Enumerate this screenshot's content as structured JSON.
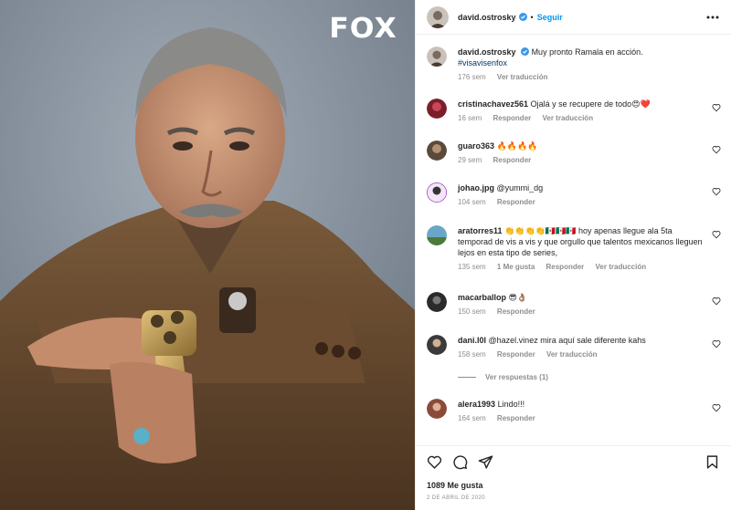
{
  "media": {
    "brand": "FOX"
  },
  "header": {
    "username": "david.ostrosky",
    "separator": "•",
    "follow_label": "Seguir"
  },
  "caption": {
    "username": "david.ostrosky",
    "text": "Muy pronto Ramala en acción.",
    "hashtag": "#visavisenfox",
    "time": "176 sem",
    "translate": "Ver traducción"
  },
  "comments": [
    {
      "username": "cristinachavez561",
      "text": "Ojalá y se recupere de todo😍❤️",
      "time": "16 sem",
      "likes": "",
      "reply": "Responder",
      "translate": "Ver traducción"
    },
    {
      "username": "guaro363",
      "text": "🔥🔥🔥🔥",
      "time": "29 sem",
      "likes": "",
      "reply": "Responder",
      "translate": ""
    },
    {
      "username": "johao.jpg",
      "text": "@yummi_dg",
      "time": "104 sem",
      "likes": "",
      "reply": "Responder",
      "translate": ""
    },
    {
      "username": "aratorres11",
      "text": "👏👏👏👏🇲🇽🇲🇽🇲🇽 hoy apenas llegue ala 5ta temporad de vis a vis y que orgullo que talentos mexicanos lleguen lejos en esta tipo de series,",
      "time": "135 sem",
      "likes": "1 Me gusta",
      "reply": "Responder",
      "translate": "Ver traducción"
    },
    {
      "username": "macarballop",
      "text": "😎👌🏽",
      "time": "150 sem",
      "likes": "",
      "reply": "Responder",
      "translate": ""
    },
    {
      "username": "dani.l0l",
      "text": "@hazel.vinez mira aquí sale diferente kahs",
      "time": "158 sem",
      "likes": "",
      "reply": "Responder",
      "translate": "Ver traducción"
    },
    {
      "username": "alera1993",
      "text": "Lindo!!!",
      "time": "164 sem",
      "likes": "",
      "reply": "Responder",
      "translate": ""
    }
  ],
  "view_replies": "Ver respuestas (1)",
  "footer": {
    "likes": "1089 Me gusta",
    "date": "2 DE ABRIL DE 2020"
  },
  "colors": {
    "link_blue": "#0095f6",
    "verified_blue": "#3897f0",
    "muted": "#8e8e8e"
  },
  "icons": [
    "more-icon",
    "verified-icon",
    "heart-icon",
    "comment-icon",
    "share-icon",
    "save-icon"
  ]
}
